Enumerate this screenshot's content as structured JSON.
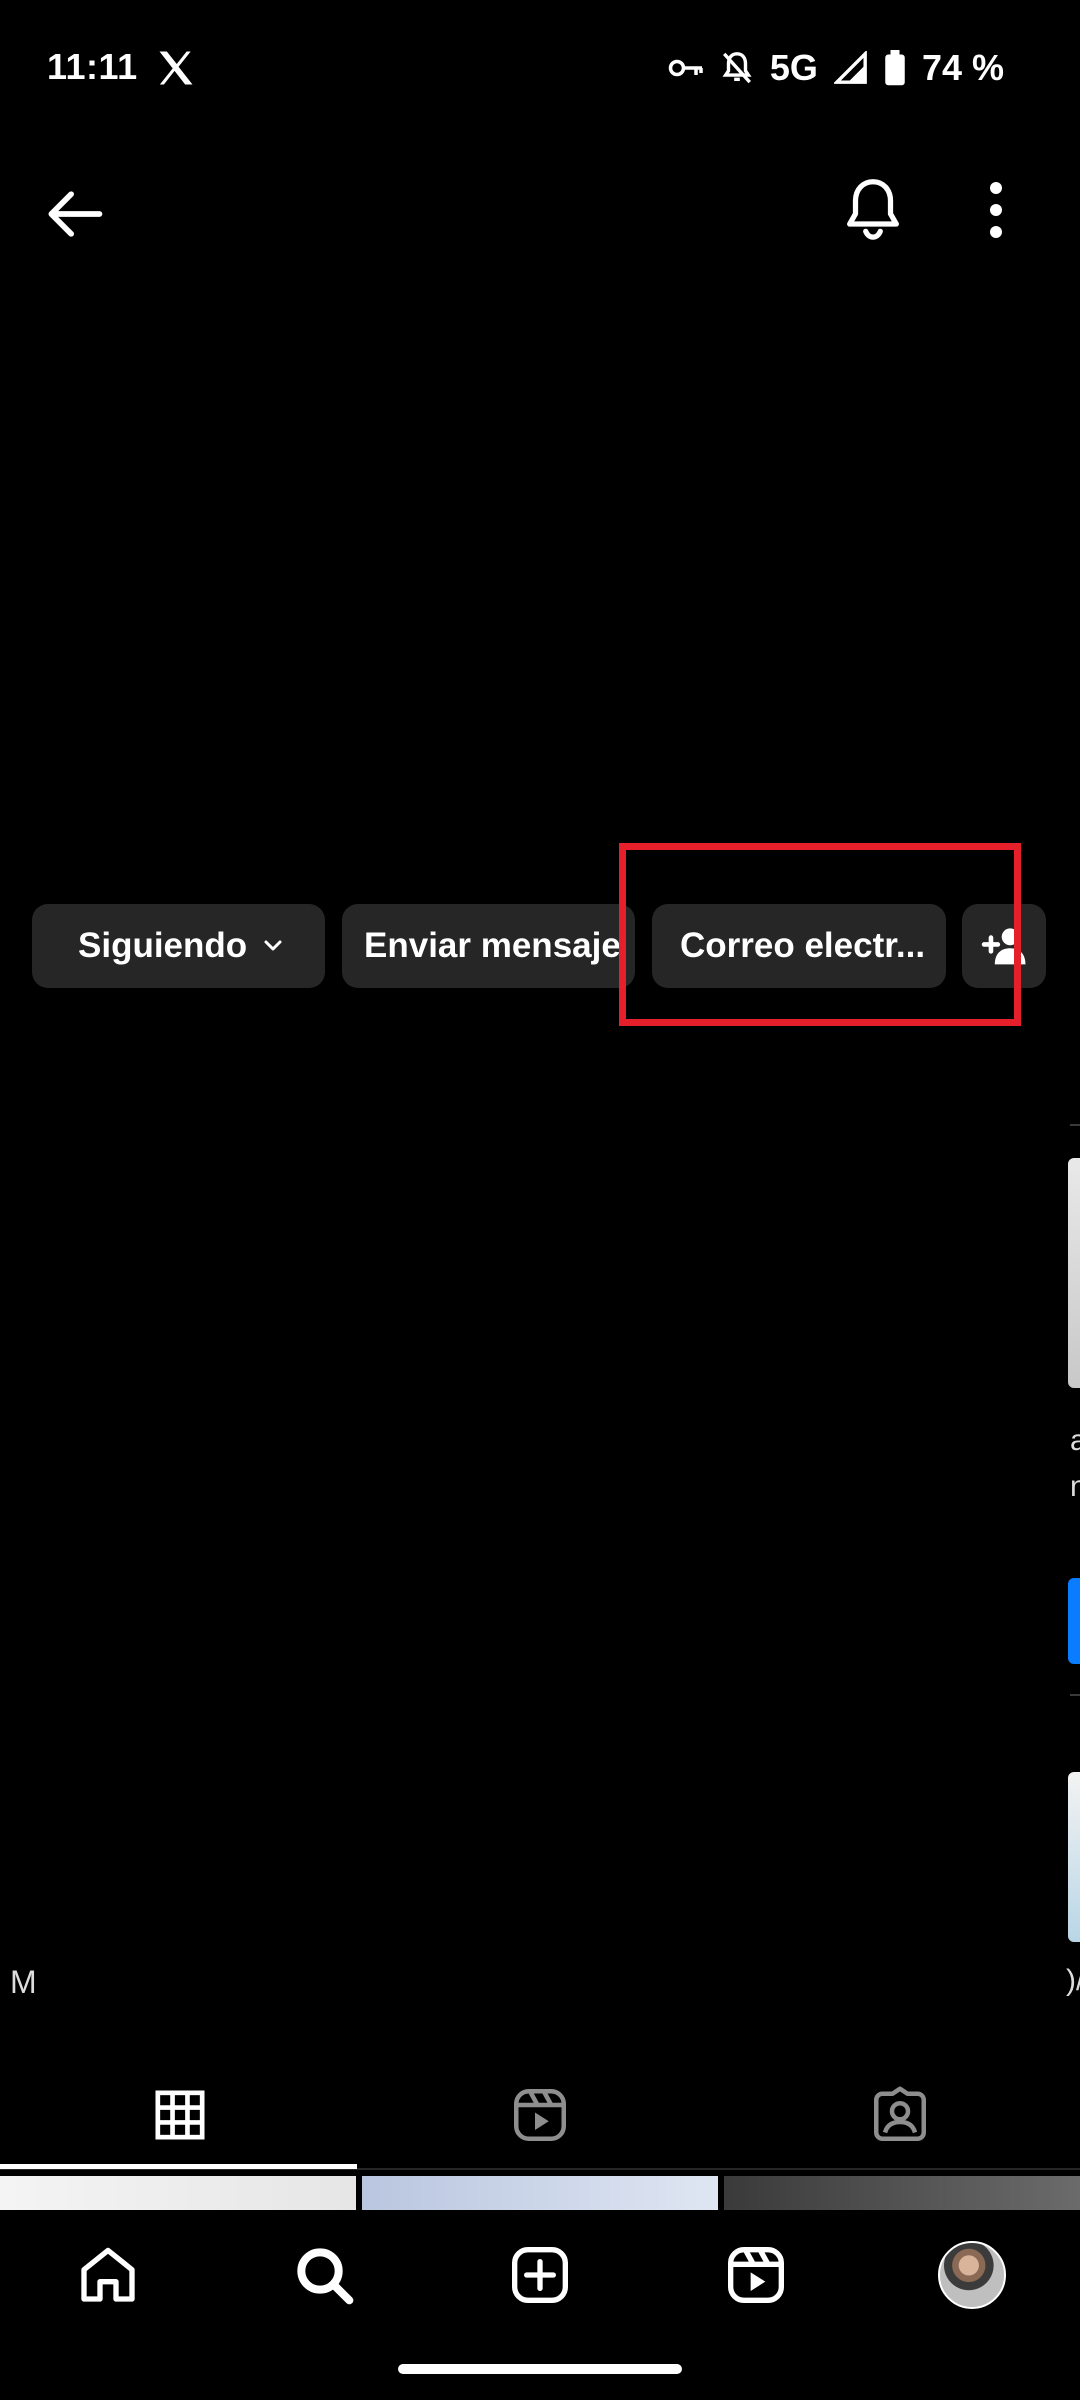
{
  "status_bar": {
    "time": "11:11",
    "network": "5G",
    "battery": "74 %",
    "icons": [
      "x-icon",
      "vpn-key-icon",
      "silent-icon",
      "signal-icon",
      "battery-icon"
    ]
  },
  "top_bar": {
    "icons": [
      "back-arrow-icon",
      "bell-icon",
      "more-vertical-icon"
    ]
  },
  "actions": {
    "following_label": "Siguiendo",
    "message_label": "Enviar mensaje",
    "email_label": "Correo electr...",
    "add_user_icon": "add-person-icon"
  },
  "highlight": {
    "color": "#e5202a"
  },
  "edge_fragments": {
    "text_1": "a",
    "text_2": "n",
    "text_3": ")/",
    "left_char": "M"
  },
  "profile_tabs": [
    "grid-icon",
    "reels-icon",
    "tagged-icon"
  ],
  "bottom_nav": [
    "home-icon",
    "search-icon",
    "create-icon",
    "reels-icon",
    "profile-avatar"
  ],
  "colors": {
    "background": "#000000",
    "pill": "#262626",
    "text": "#ffffff",
    "accent_blue": "#0a7cff"
  }
}
